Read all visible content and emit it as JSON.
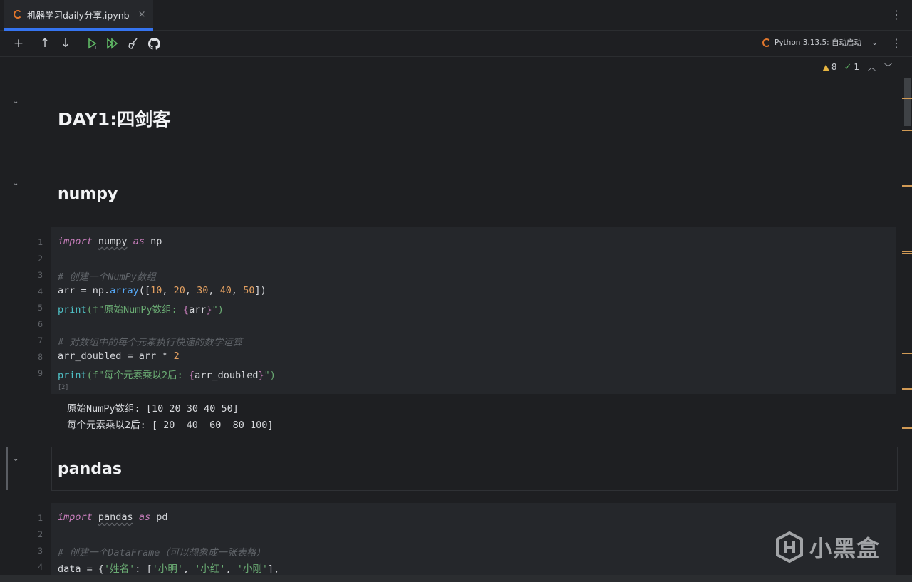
{
  "tab": {
    "title": "机器学习daily分享.ipynb",
    "close": "×"
  },
  "toolbar": {
    "add": "+",
    "move_up": "↑",
    "move_down": "↓",
    "kernel_label": "Python 3.13.5: 自动启动",
    "more": "⋮"
  },
  "inspections": {
    "warnings": "8",
    "ok": "1"
  },
  "cells": {
    "h1": "DAY1:四剑客",
    "numpy_heading": "numpy",
    "numpy_code": {
      "line_numbers": [
        "1",
        "2",
        "3",
        "4",
        "5",
        "6",
        "7",
        "8",
        "9"
      ],
      "kw_import": "import",
      "mod_numpy": "numpy",
      "kw_as": "as",
      "alias_np": "np",
      "comment1": "# 创建一个NumPy数组",
      "arr_assign": "arr = np.",
      "fn_array": "array",
      "open": "([",
      "n10": "10",
      "n20": "20",
      "n30": "30",
      "n40": "40",
      "n50": "50",
      "close": "])",
      "comma": ", ",
      "print": "print",
      "fstr1_prefix": "(f\"原始NumPy数组: ",
      "lbrace": "{",
      "var_arr": "arr",
      "rbrace": "}",
      "fstr_end": "\")",
      "comment2": "# 对数组中的每个元素执行快速的数学运算",
      "doubled_assign": "arr_doubled = arr * ",
      "n2": "2",
      "fstr2_prefix": "(f\"每个元素乘以2后: ",
      "var_doubled": "arr_doubled",
      "exec_count": "[2]"
    },
    "numpy_output": [
      "原始NumPy数组: [10 20 30 40 50]",
      "每个元素乘以2后: [ 20  40  60  80 100]"
    ],
    "pandas_heading": "pandas",
    "pandas_code": {
      "line_numbers": [
        "1",
        "2",
        "3",
        "4"
      ],
      "kw_import": "import",
      "mod_pandas": "pandas",
      "kw_as": "as",
      "alias_pd": "pd",
      "comment1": "# 创建一个DataFrame（可以想象成一张表格）",
      "data_prefix": "data = {",
      "key_name": "'姓名'",
      "colon_open": ": [",
      "v1": "'小明'",
      "v2": "'小红'",
      "v3": "'小刚'",
      "sep": ", ",
      "line_end": "],"
    }
  },
  "watermark": {
    "text": "小黑盒"
  }
}
